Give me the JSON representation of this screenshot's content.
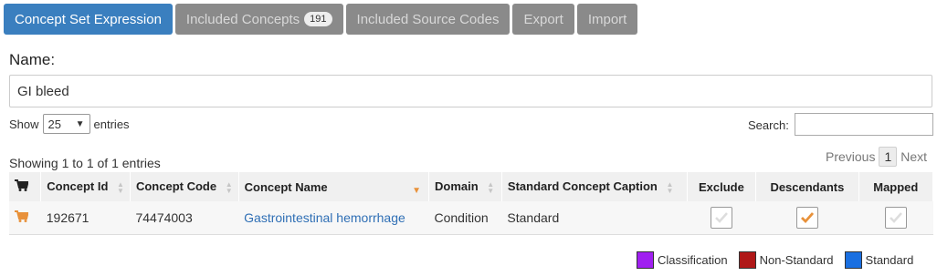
{
  "tabs": [
    {
      "label": "Concept Set Expression"
    },
    {
      "label": "Included Concepts",
      "badge": "191"
    },
    {
      "label": "Included Source Codes"
    },
    {
      "label": "Export"
    },
    {
      "label": "Import"
    }
  ],
  "name": {
    "label": "Name:",
    "value": "GI bleed"
  },
  "length": {
    "show": "Show",
    "value": "25",
    "entries": "entries"
  },
  "search": {
    "label": "Search:",
    "value": ""
  },
  "info": "Showing 1 to 1 of 1 entries",
  "paging": {
    "previous": "Previous",
    "current": "1",
    "next": "Next"
  },
  "table": {
    "headers": {
      "cart": "cart-icon",
      "concept_id": "Concept Id",
      "concept_code": "Concept Code",
      "concept_name": "Concept Name",
      "domain": "Domain",
      "standard_caption": "Standard Concept Caption",
      "exclude": "Exclude",
      "descendants": "Descendants",
      "mapped": "Mapped"
    },
    "rows": [
      {
        "concept_id": "192671",
        "concept_code": "74474003",
        "concept_name": "Gastrointestinal hemorrhage",
        "domain": "Condition",
        "standard_caption": "Standard",
        "exclude": false,
        "descendants": true,
        "mapped": false
      }
    ]
  },
  "legend": [
    {
      "label": "Classification",
      "color": "#a020f0"
    },
    {
      "label": "Non-Standard",
      "color": "#b01818"
    },
    {
      "label": "Standard",
      "color": "#1a6fe0"
    }
  ],
  "colors": {
    "accent": "#3a7fbf",
    "orange": "#e8913a",
    "tab_inactive": "#8a8a8a"
  }
}
